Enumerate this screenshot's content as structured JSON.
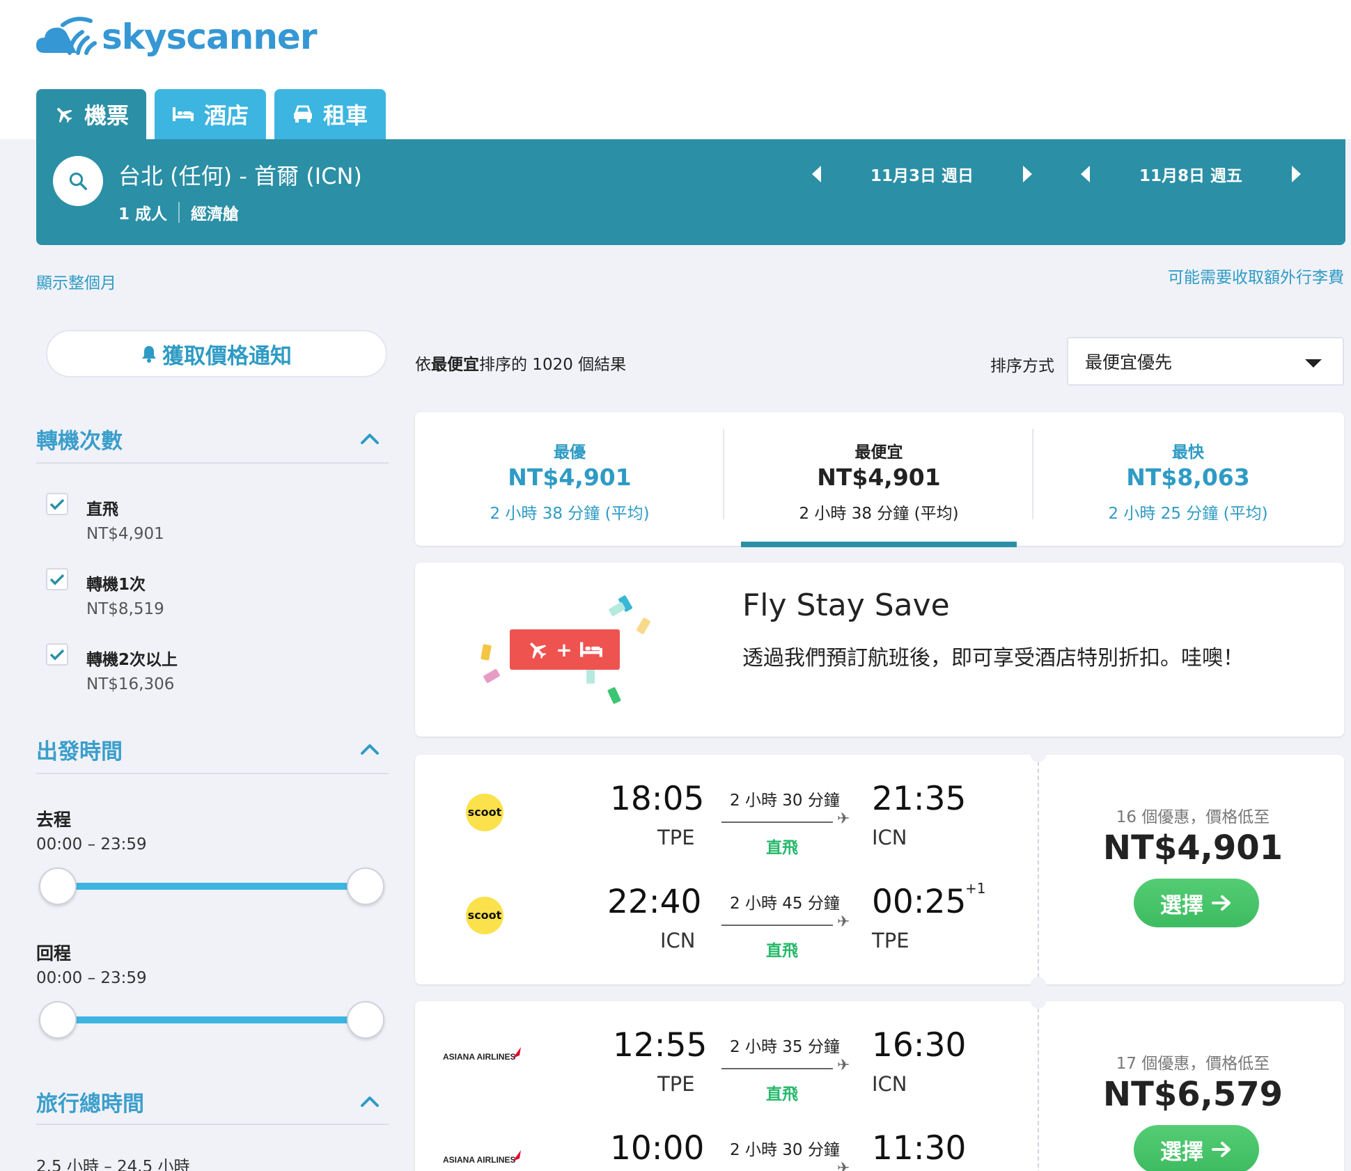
{
  "brand": {
    "name": "skyscanner"
  },
  "tabs": [
    {
      "label": "機票",
      "icon": "plane-icon",
      "active": true
    },
    {
      "label": "酒店",
      "icon": "bed-icon",
      "active": false
    },
    {
      "label": "租車",
      "icon": "car-icon",
      "active": false
    }
  ],
  "search": {
    "route": "台北 (任何) - 首爾 (ICN)",
    "passengers": "1 成人",
    "cabin": "經濟艙",
    "depart_date": "11月3日 週日",
    "return_date": "11月8日 週五"
  },
  "links": {
    "show_month": "顯示整個月",
    "baggage_fee": "可能需要收取額外行李費"
  },
  "price_alert": {
    "label": "獲取價格通知"
  },
  "filters": {
    "stops": {
      "title": "轉機次數",
      "options": [
        {
          "label": "直飛",
          "price": "NT$4,901",
          "checked": true
        },
        {
          "label": "轉機1次",
          "price": "NT$8,519",
          "checked": true
        },
        {
          "label": "轉機2次以上",
          "price": "NT$16,306",
          "checked": true
        }
      ]
    },
    "departure_times": {
      "title": "出發時間",
      "outbound_label": "去程",
      "outbound_range": "00:00 – 23:59",
      "return_label": "回程",
      "return_range": "00:00 – 23:59"
    },
    "journey_duration": {
      "title": "旅行總時間",
      "range": "2.5 小時 – 24.5 小時"
    }
  },
  "results": {
    "count_prefix": "依",
    "count_bold": "最便宜",
    "count_suffix": "排序的 1020 個結果",
    "sort_label": "排序方式",
    "sort_value": "最便宜優先"
  },
  "summary": [
    {
      "label": "最優",
      "price": "NT$4,901",
      "duration": "2 小時 38 分鐘 (平均)",
      "selected": false
    },
    {
      "label": "最便宜",
      "price": "NT$4,901",
      "duration": "2 小時 38 分鐘 (平均)",
      "selected": true
    },
    {
      "label": "最快",
      "price": "NT$8,063",
      "duration": "2 小時 25 分鐘 (平均)",
      "selected": false
    }
  ],
  "promo": {
    "title": "Fly Stay Save",
    "text": "透過我們預訂航班後，即可享受酒店特別折扣。哇噢！",
    "badge_plus": "+"
  },
  "flights": [
    {
      "legs": [
        {
          "airline": "scoot",
          "dep_time": "18:05",
          "dep_code": "TPE",
          "duration": "2 小時 30 分鐘",
          "stops": "直飛",
          "arr_time": "21:35",
          "arr_code": "ICN",
          "day_offset": ""
        },
        {
          "airline": "scoot",
          "dep_time": "22:40",
          "dep_code": "ICN",
          "duration": "2 小時 45 分鐘",
          "stops": "直飛",
          "arr_time": "00:25",
          "arr_code": "TPE",
          "day_offset": "+1"
        }
      ],
      "deals": "16 個優惠，價格低至",
      "price": "NT$4,901",
      "select_label": "選擇"
    },
    {
      "legs": [
        {
          "airline": "ASIANA AIRLINES",
          "dep_time": "12:55",
          "dep_code": "TPE",
          "duration": "2 小時 35 分鐘",
          "stops": "直飛",
          "arr_time": "16:30",
          "arr_code": "ICN",
          "day_offset": ""
        },
        {
          "airline": "ASIANA AIRLINES",
          "dep_time": "10:00",
          "dep_code": "",
          "duration": "2 小時 30 分鐘",
          "stops": "",
          "arr_time": "11:30",
          "arr_code": "",
          "day_offset": ""
        }
      ],
      "deals": "17 個優惠，價格低至",
      "price": "NT$6,579",
      "select_label": "選擇"
    }
  ],
  "colors": {
    "brand_blue": "#3597d3",
    "tab_active": "#2b8fa6",
    "tab_inactive": "#3cb5e1",
    "link": "#2e9bc4",
    "select_green": "#4cc96d",
    "direct_green": "#25b86a",
    "promo_red": "#ef5350"
  }
}
